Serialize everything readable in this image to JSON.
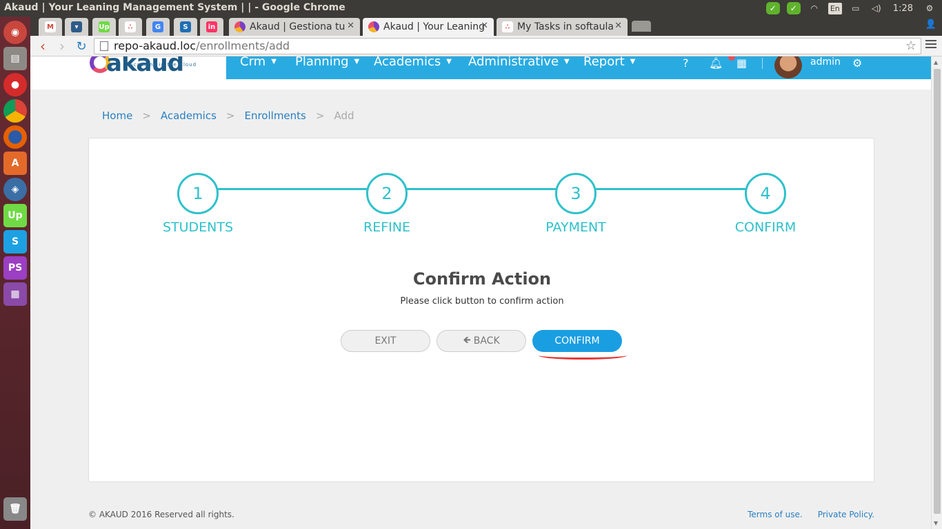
{
  "window": {
    "title": "Akaud | Your Leaning Management System | | - Google Chrome",
    "clock": "1:28",
    "keyboard": "En"
  },
  "tabs": [
    {
      "label": "",
      "icon": "gmail-icon"
    },
    {
      "label": "",
      "icon": "bucket-icon"
    },
    {
      "label": "",
      "icon": "upwork-icon"
    },
    {
      "label": "",
      "icon": "asana-icon"
    },
    {
      "label": "",
      "icon": "translate-icon"
    },
    {
      "label": "",
      "icon": "s-icon"
    },
    {
      "label": "",
      "icon": "invision-icon"
    },
    {
      "label": "Akaud | Gestiona tu",
      "icon": "akaud-icon"
    },
    {
      "label": "Akaud | Your Leaning",
      "icon": "akaud-icon",
      "active": true
    },
    {
      "label": "My Tasks in softaula",
      "icon": "asana-icon"
    }
  ],
  "address": {
    "host": "repo-akaud.loc",
    "path": "/enrollments/add"
  },
  "header": {
    "logo_text": "akaud",
    "logo_tagline": "Academy in the Cloud",
    "nav": [
      "Crm",
      "Planning",
      "Academics",
      "Administrative",
      "Report"
    ],
    "user": "admin"
  },
  "breadcrumb": {
    "home": "Home",
    "academics": "Academics",
    "enrollments": "Enrollments",
    "current": "Add",
    "sep": ">"
  },
  "wizard": {
    "steps": [
      {
        "num": "1",
        "label": "STUDENTS"
      },
      {
        "num": "2",
        "label": "REFINE"
      },
      {
        "num": "3",
        "label": "PAYMENT"
      },
      {
        "num": "4",
        "label": "CONFIRM"
      }
    ]
  },
  "confirm": {
    "title": "Confirm Action",
    "subtitle": "Please click button to confirm action",
    "exit_label": "EXIT",
    "back_label": "BACK",
    "confirm_label": "CONFIRM",
    "accent": "#1a9ee2",
    "wizard_color": "#2ec1cb"
  },
  "footer": {
    "copyright": "© AKAUD 2016 Reserved all rights.",
    "terms": "Terms of use.",
    "privacy": "Private Policy."
  }
}
